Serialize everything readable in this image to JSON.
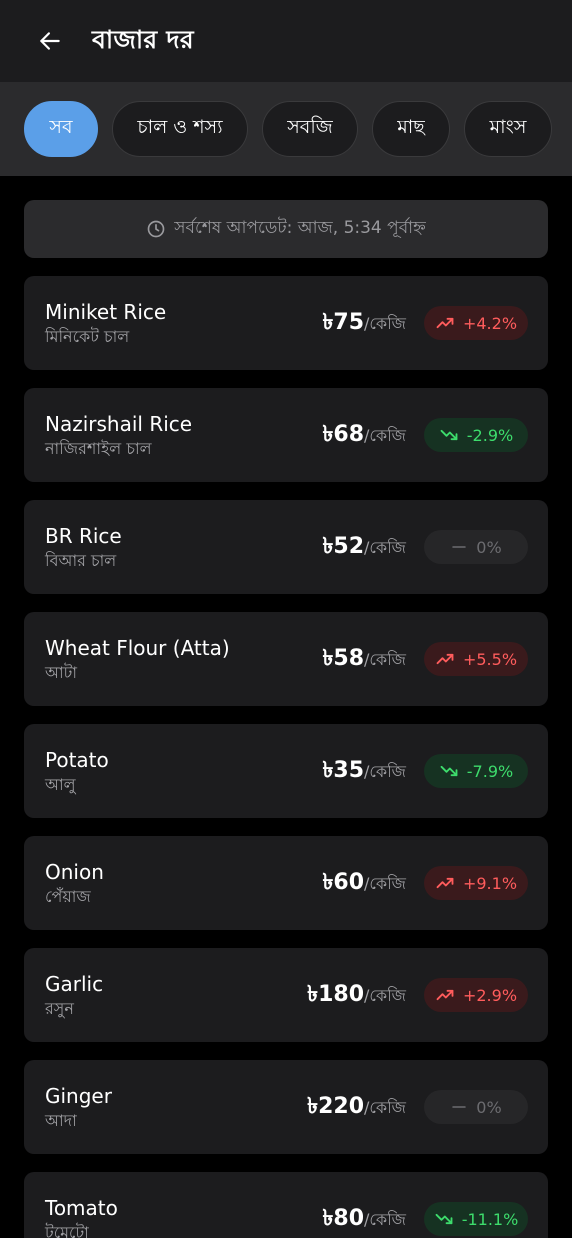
{
  "header": {
    "title": "বাজার দর"
  },
  "chips": [
    {
      "label": "সব",
      "active": true
    },
    {
      "label": "চাল ও শস্য",
      "active": false
    },
    {
      "label": "সবজি",
      "active": false
    },
    {
      "label": "মাছ",
      "active": false
    },
    {
      "label": "মাংস",
      "active": false
    }
  ],
  "update": {
    "text": "সর্বশেষ আপডেট: আজ, 5:34 পূর্বাহ্ন"
  },
  "items": [
    {
      "name_en": "Miniket Rice",
      "name_bn": "মিনিকেট চাল",
      "price": "৳75",
      "unit": "/কেজি",
      "change": "+4.2%",
      "trend": "up"
    },
    {
      "name_en": "Nazirshail Rice",
      "name_bn": "নাজিরশাইল চাল",
      "price": "৳68",
      "unit": "/কেজি",
      "change": "-2.9%",
      "trend": "down"
    },
    {
      "name_en": "BR Rice",
      "name_bn": "বিআর চাল",
      "price": "৳52",
      "unit": "/কেজি",
      "change": "0%",
      "trend": "flat"
    },
    {
      "name_en": "Wheat Flour (Atta)",
      "name_bn": "আটা",
      "price": "৳58",
      "unit": "/কেজি",
      "change": "+5.5%",
      "trend": "up"
    },
    {
      "name_en": "Potato",
      "name_bn": "আলু",
      "price": "৳35",
      "unit": "/কেজি",
      "change": "-7.9%",
      "trend": "down"
    },
    {
      "name_en": "Onion",
      "name_bn": "পেঁয়াজ",
      "price": "৳60",
      "unit": "/কেজি",
      "change": "+9.1%",
      "trend": "up"
    },
    {
      "name_en": "Garlic",
      "name_bn": "রসুন",
      "price": "৳180",
      "unit": "/কেজি",
      "change": "+2.9%",
      "trend": "up"
    },
    {
      "name_en": "Ginger",
      "name_bn": "আদা",
      "price": "৳220",
      "unit": "/কেজি",
      "change": "0%",
      "trend": "flat"
    },
    {
      "name_en": "Tomato",
      "name_bn": "টমেটো",
      "price": "৳80",
      "unit": "/কেজি",
      "change": "-11.1%",
      "trend": "down"
    }
  ],
  "colors": {
    "accent": "#5b9fe8",
    "up": "#ff5c5c",
    "down": "#3ddc6c",
    "flat": "#6c6c70"
  },
  "icons": {
    "back": "arrow-left-icon",
    "clock": "clock-icon",
    "up": "trending-up-icon",
    "down": "trending-down-icon",
    "flat": "minus-icon"
  }
}
